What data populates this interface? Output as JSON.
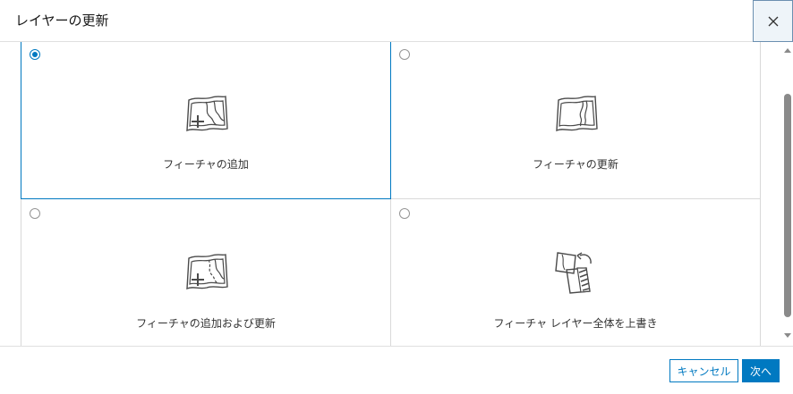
{
  "dialog": {
    "title": "レイヤーの更新",
    "close_icon": "close-icon"
  },
  "options": [
    {
      "label": "フィーチャの追加",
      "icon": "map-add-icon",
      "selected": true
    },
    {
      "label": "フィーチャの更新",
      "icon": "map-update-icon",
      "selected": false
    },
    {
      "label": "フィーチャの追加および更新",
      "icon": "map-add-update-icon",
      "selected": false
    },
    {
      "label": "フィーチャ レイヤー全体を上書き",
      "icon": "overwrite-layer-icon",
      "selected": false
    }
  ],
  "footer": {
    "cancel_label": "キャンセル",
    "next_label": "次へ"
  },
  "colors": {
    "accent": "#0079c1",
    "border": "#d9d9d9",
    "text": "#323232"
  }
}
